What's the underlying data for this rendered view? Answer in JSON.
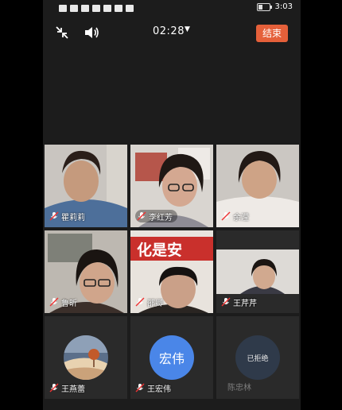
{
  "status_bar": {
    "time": "3:03"
  },
  "toolbar": {
    "timer": "02:28",
    "end_label": "结束"
  },
  "participants": [
    {
      "name": "瞿莉莉"
    },
    {
      "name": "李红芳"
    },
    {
      "name": "余滢"
    },
    {
      "name": "鲁昕"
    },
    {
      "name": "邵卿"
    },
    {
      "name": "王芹芹"
    },
    {
      "name": "王燕蕾"
    },
    {
      "name": "王宏伟",
      "avatar_text": "宏伟"
    },
    {
      "name": "陈忠林",
      "status": "已拒绝"
    }
  ],
  "banner_text": "化是安",
  "colors": {
    "end_button": "#e5603a",
    "avatar_blue": "#4a86e8"
  }
}
